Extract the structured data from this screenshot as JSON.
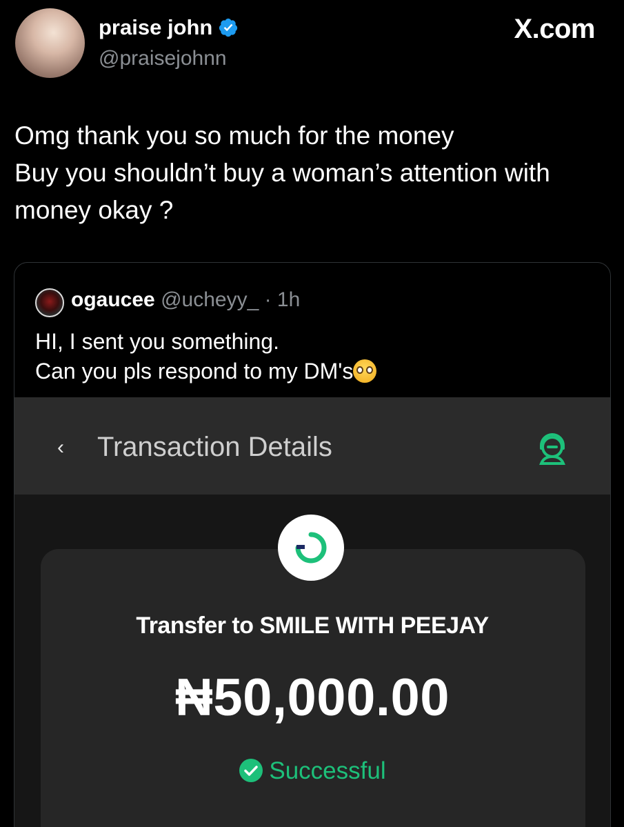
{
  "author": {
    "name": "praise john",
    "handle": "@praisejohnn",
    "verified": true,
    "verified_color": "#1d9bf0"
  },
  "site_mark": "X.com",
  "tweet": {
    "lines": [
      "Omg thank you so much for the money",
      "Buy you shouldn’t buy a woman’s attention with",
      "money okay ?"
    ]
  },
  "quoted": {
    "name": "ogaucee",
    "handle": "@ucheyy_",
    "time": "· 1h",
    "lines": [
      "HI, I sent you something.",
      "Can you pls respond to my DM's"
    ],
    "emoji": "pleading-face-emoji"
  },
  "screenshot": {
    "back_icon": "‹",
    "title": "Transaction Details",
    "support_icon": "headset-support-icon",
    "transfer_label": "Transfer to SMILE WITH PEEJAY",
    "amount": "₦50,000.00",
    "status": "Successful",
    "status_color": "#1dc07a",
    "accent": "#1dc07a"
  }
}
